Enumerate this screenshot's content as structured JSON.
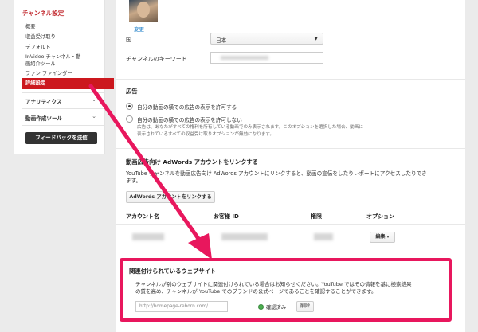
{
  "sidebar": {
    "section_title": "チャンネル設定",
    "items": [
      {
        "label": "概要"
      },
      {
        "label": "収益受け取り"
      },
      {
        "label": "デフォルト"
      },
      {
        "label": "InVideo チャンネル・動"
      },
      {
        "label": "画紹介ツール"
      },
      {
        "label": "ファン ファインダー"
      },
      {
        "label": "詳細設定"
      }
    ],
    "groups": [
      {
        "label": "アナリティクス"
      },
      {
        "label": "動画作成ツール"
      }
    ],
    "feedback_button": "フィードバックを送信"
  },
  "profile": {
    "change_link": "変更"
  },
  "country": {
    "label": "国",
    "value": "日本"
  },
  "keywords": {
    "label": "チャンネルのキーワード"
  },
  "ads": {
    "title": "広告",
    "allow_label": "自分の動画の横での広告の表示を許可する",
    "deny_label": "自分の動画の横での広告の表示を許可しない",
    "note_line1": "広告は、あなたがすべての権利を所有している動画でのみ表示されます。このオプションを選択した場合、動画に",
    "note_line2": "表示されているすべての収益受け取りオプションが無効になります。"
  },
  "adwords": {
    "title": "動画広告向け AdWords アカウントをリンクする",
    "description_line1": "YouTube チャンネルを動画広告向け AdWords アカウントにリンクすると、動画の宣伝をしたりレポートにアクセスしたりでき",
    "description_line2": "ます。",
    "link_button": "AdWords アカウントをリンクする",
    "columns": [
      "アカウント名",
      "お客様 ID",
      "権限",
      "オプション"
    ],
    "edit_button": "編集 ▾"
  },
  "associated_site": {
    "title": "関連付けられているウェブサイト",
    "description_line1": "チャンネルが別のウェブサイトに関連付けられている場合はお知らせください。YouTube ではその情報を基に検索結果",
    "description_line2": "の質を高め、チャンネルが YouTube でのブランドの公式ページであることを確認することができます。",
    "url_placeholder": "http://homepage-reborn.com/",
    "verified_label": "確認済み",
    "delete_button": "削除"
  },
  "colors": {
    "accent_red": "#cc181e",
    "highlight": "#e8175d",
    "link_blue": "#167ac6",
    "verified_green": "#4caf50"
  }
}
